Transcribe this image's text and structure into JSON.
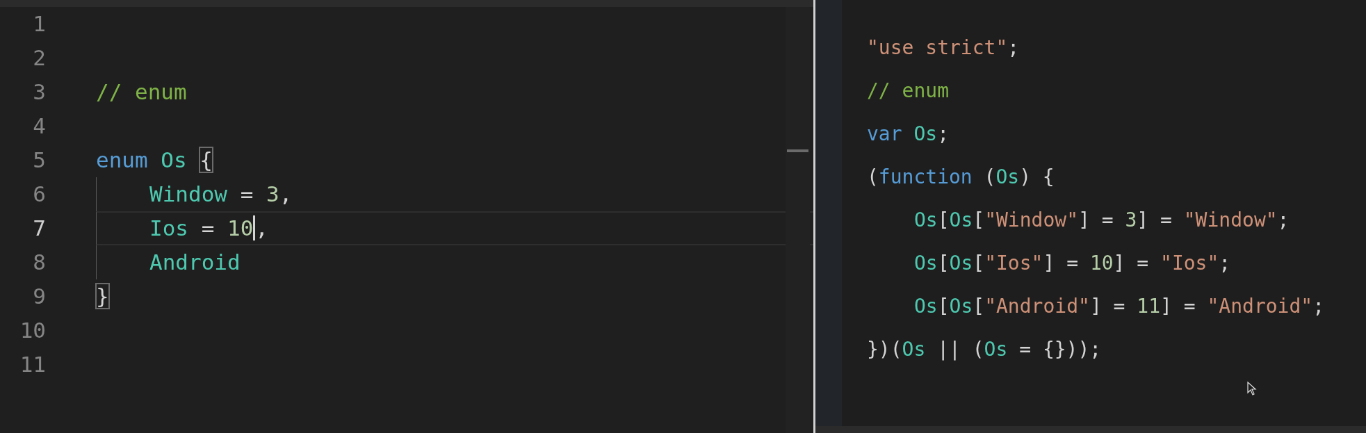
{
  "left_editor": {
    "lines": [
      {
        "number": "1",
        "active": false
      },
      {
        "number": "2",
        "active": false
      },
      {
        "number": "3",
        "active": false,
        "tokens": [
          {
            "kind": "comment",
            "text": "// enum"
          }
        ]
      },
      {
        "number": "4",
        "active": false
      },
      {
        "number": "5",
        "active": false,
        "tokens": [
          {
            "kind": "keyword",
            "text": "enum "
          },
          {
            "kind": "type",
            "text": "Os "
          },
          {
            "kind": "plain",
            "text": "{",
            "matched": true
          }
        ]
      },
      {
        "number": "6",
        "active": false,
        "indented": true,
        "tokens": [
          {
            "kind": "type",
            "text": "Window"
          },
          {
            "kind": "plain",
            "text": " = "
          },
          {
            "kind": "number",
            "text": "3"
          },
          {
            "kind": "plain",
            "text": ","
          }
        ]
      },
      {
        "number": "7",
        "active": true,
        "indented": true,
        "tokens": [
          {
            "kind": "type",
            "text": "Ios"
          },
          {
            "kind": "plain",
            "text": " = "
          },
          {
            "kind": "number",
            "text": "10",
            "cursor": true
          },
          {
            "kind": "plain",
            "text": ","
          }
        ]
      },
      {
        "number": "8",
        "active": false,
        "indented": true,
        "tokens": [
          {
            "kind": "type",
            "text": "Android"
          }
        ]
      },
      {
        "number": "9",
        "active": false,
        "tokens": [
          {
            "kind": "plain",
            "text": "}",
            "matched": true
          }
        ]
      },
      {
        "number": "10",
        "active": false
      },
      {
        "number": "11",
        "active": false
      }
    ]
  },
  "right_output": {
    "lines": [
      {
        "tokens": [
          {
            "kind": "string",
            "text": "\"use strict\""
          },
          {
            "kind": "plain",
            "text": ";"
          }
        ]
      },
      {
        "tokens": [
          {
            "kind": "comment",
            "text": "// enum"
          }
        ]
      },
      {
        "tokens": [
          {
            "kind": "keyword",
            "text": "var "
          },
          {
            "kind": "type",
            "text": "Os"
          },
          {
            "kind": "plain",
            "text": ";"
          }
        ]
      },
      {
        "tokens": [
          {
            "kind": "plain",
            "text": "("
          },
          {
            "kind": "keyword",
            "text": "function"
          },
          {
            "kind": "plain",
            "text": " ("
          },
          {
            "kind": "type",
            "text": "Os"
          },
          {
            "kind": "plain",
            "text": ") {"
          }
        ]
      },
      {
        "indented": true,
        "tokens": [
          {
            "kind": "type",
            "text": "Os"
          },
          {
            "kind": "plain",
            "text": "["
          },
          {
            "kind": "type",
            "text": "Os"
          },
          {
            "kind": "plain",
            "text": "["
          },
          {
            "kind": "string",
            "text": "\"Window\""
          },
          {
            "kind": "plain",
            "text": "] = "
          },
          {
            "kind": "number",
            "text": "3"
          },
          {
            "kind": "plain",
            "text": "] = "
          },
          {
            "kind": "string",
            "text": "\"Window\""
          },
          {
            "kind": "plain",
            "text": ";"
          }
        ]
      },
      {
        "indented": true,
        "tokens": [
          {
            "kind": "type",
            "text": "Os"
          },
          {
            "kind": "plain",
            "text": "["
          },
          {
            "kind": "type",
            "text": "Os"
          },
          {
            "kind": "plain",
            "text": "["
          },
          {
            "kind": "string",
            "text": "\"Ios\""
          },
          {
            "kind": "plain",
            "text": "] = "
          },
          {
            "kind": "number",
            "text": "10"
          },
          {
            "kind": "plain",
            "text": "] = "
          },
          {
            "kind": "string",
            "text": "\"Ios\""
          },
          {
            "kind": "plain",
            "text": ";"
          }
        ]
      },
      {
        "indented": true,
        "tokens": [
          {
            "kind": "type",
            "text": "Os"
          },
          {
            "kind": "plain",
            "text": "["
          },
          {
            "kind": "type",
            "text": "Os"
          },
          {
            "kind": "plain",
            "text": "["
          },
          {
            "kind": "string",
            "text": "\"Android\""
          },
          {
            "kind": "plain",
            "text": "] = "
          },
          {
            "kind": "number",
            "text": "11"
          },
          {
            "kind": "plain",
            "text": "] = "
          },
          {
            "kind": "string",
            "text": "\"Android\""
          },
          {
            "kind": "plain",
            "text": ";"
          }
        ]
      },
      {
        "tokens": [
          {
            "kind": "plain",
            "text": "})("
          },
          {
            "kind": "type",
            "text": "Os"
          },
          {
            "kind": "plain",
            "text": " || ("
          },
          {
            "kind": "type",
            "text": "Os"
          },
          {
            "kind": "plain",
            "text": " = {}));"
          }
        ]
      }
    ]
  }
}
